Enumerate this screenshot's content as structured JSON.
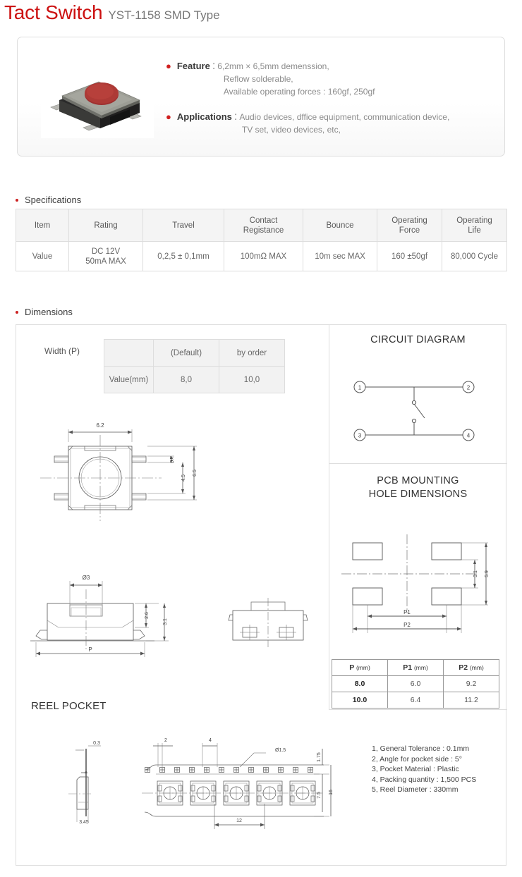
{
  "title": {
    "main": "Tact Switch",
    "sub": "YST-1158 SMD Type"
  },
  "banner": {
    "photo_alt": "tact-switch-product-photo",
    "feature": {
      "label": "Feature",
      "colon": ":",
      "lines": [
        "6,2mm × 6,5mm demenssion,",
        "Reflow solderable,",
        "Available operating forces : 160gf, 250gf"
      ]
    },
    "applications": {
      "label": "Applications",
      "colon": ":",
      "lines": [
        "Audio devices, dffice equipment, communication device,",
        "TV set, video devices, etc,"
      ]
    }
  },
  "specifications": {
    "heading": "Specifications",
    "headers": [
      "Item",
      "Rating",
      "Travel",
      "Contact\nRegistance",
      "Bounce",
      "Operating\nForce",
      "Operating\nLife"
    ],
    "header_lines": [
      [
        "Item"
      ],
      [
        "Rating"
      ],
      [
        "Travel"
      ],
      [
        "Contact",
        "Registance"
      ],
      [
        "Bounce"
      ],
      [
        "Operating",
        "Force"
      ],
      [
        "Operating",
        "Life"
      ]
    ],
    "row_label": "Value",
    "values": [
      [
        "DC 12V",
        "50mA MAX"
      ],
      [
        "0,2,5 ± 0,1mm"
      ],
      [
        "100mΩ MAX"
      ],
      [
        "10m sec MAX"
      ],
      [
        "160 ±50gf"
      ],
      [
        "80,000 Cycle"
      ]
    ]
  },
  "dimensions": {
    "heading": "Dimensions",
    "width_p": {
      "label": "Width (P)",
      "col_headers": [
        "",
        "(Default)",
        "by order"
      ],
      "row_label": "Value(mm)",
      "row_values": [
        "8,0",
        "10,0"
      ]
    },
    "top_view": {
      "width": "6.2",
      "d07": "0.7",
      "d45": "4.5",
      "d65": "6.5"
    },
    "side_view": {
      "diameter": "Ø3",
      "h26": "2.6",
      "h31": "3.1",
      "width_p": "P"
    },
    "circuit": {
      "title": "CIRCUIT DIAGRAM",
      "pins": [
        "①",
        "②",
        "③",
        "④"
      ]
    },
    "pcb": {
      "title_line1": "PCB MOUNTING",
      "title_line2": "HOLE DIMENSIONS",
      "d31": "3.1",
      "d59": "5.9",
      "p1": "P1",
      "p2": "P2"
    },
    "p_table": {
      "headers": [
        {
          "name": "P",
          "unit": "(mm)"
        },
        {
          "name": "P1",
          "unit": "(mm)"
        },
        {
          "name": "P2",
          "unit": "(mm)"
        }
      ],
      "rows": [
        [
          "8.0",
          "6.0",
          "9.2"
        ],
        [
          "10.0",
          "6.4",
          "11.2"
        ]
      ]
    },
    "reel": {
      "title": "REEL POCKET",
      "cross_top": "0.3",
      "cross_bottom": "3.45",
      "pitch2": "2",
      "pitch4": "4",
      "hole_dia": "Ø1.5",
      "d175": "1.75",
      "d75": "7.5",
      "d16": "16",
      "d12": "12"
    },
    "notes": [
      "1, General Tolerance : 0.1mm",
      "2, Angle for pocket side : 5°",
      "3, Pocket Material : Plastic",
      "4, Packing quantity : 1,500 PCS",
      "5, Reel Diameter : 330mm"
    ]
  },
  "colors": {
    "title_red": "#cc1111",
    "bullet_red": "#cc2222",
    "text_gray": "#8b8b8b",
    "button_red": "#9e3030"
  }
}
